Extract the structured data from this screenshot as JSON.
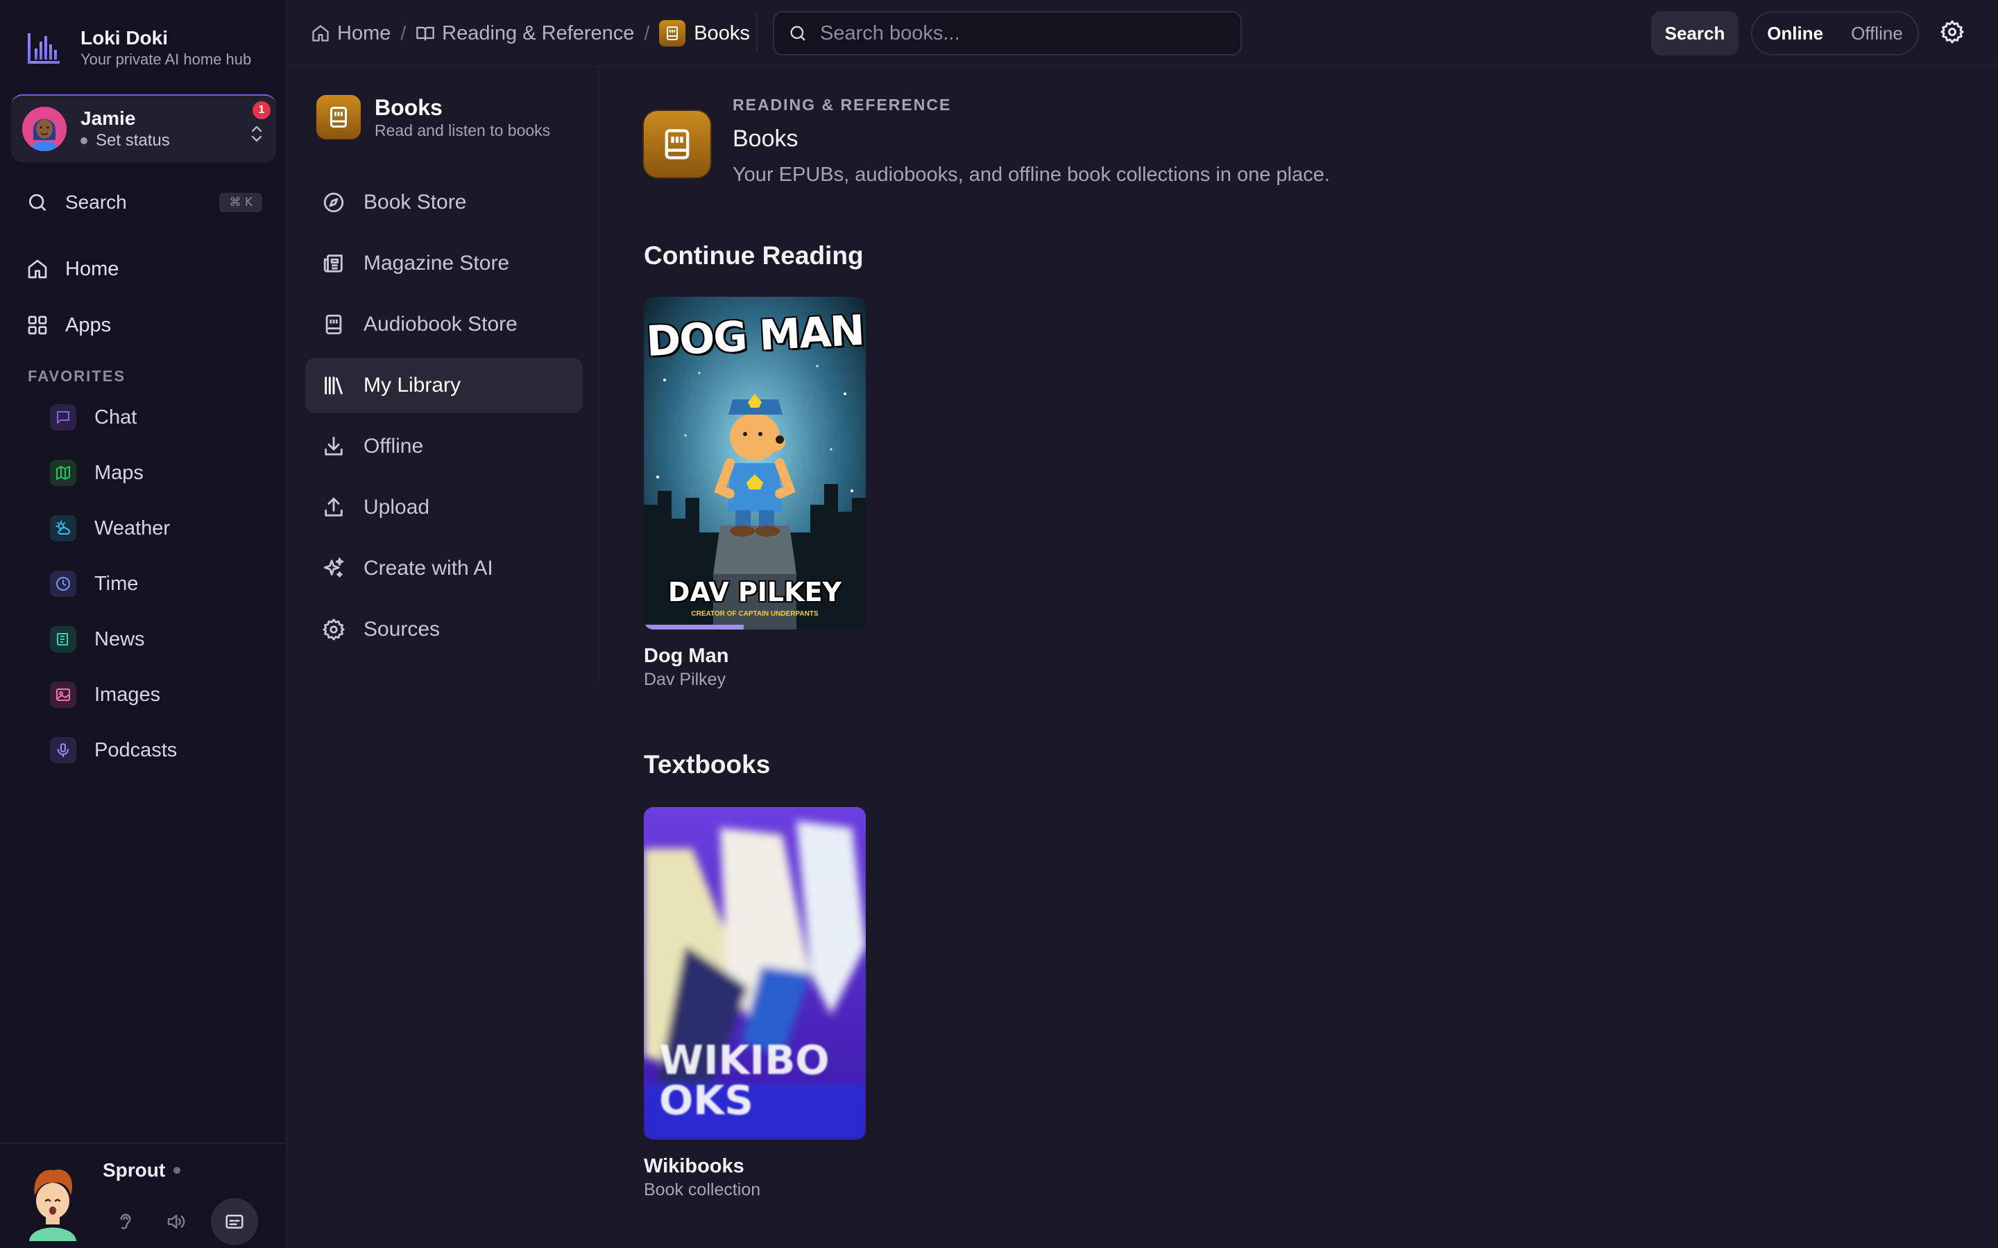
{
  "brand": {
    "name": "Loki Doki",
    "subtitle": "Your private AI home hub"
  },
  "user": {
    "name": "Jamie",
    "status": "Set status",
    "notifications": "1"
  },
  "sidebar": {
    "search_label": "Search",
    "search_shortcut": "⌘ K",
    "nav": [
      {
        "label": "Home",
        "icon": "home-icon"
      },
      {
        "label": "Apps",
        "icon": "grid-icon"
      }
    ],
    "favorites_heading": "FAVORITES",
    "favorites": [
      {
        "label": "Chat",
        "icon": "chat-icon",
        "color": "#8b5cf6"
      },
      {
        "label": "Maps",
        "icon": "map-icon",
        "color": "#22c55e"
      },
      {
        "label": "Weather",
        "icon": "weather-icon",
        "color": "#38bdf8"
      },
      {
        "label": "Time",
        "icon": "clock-icon",
        "color": "#818cf8"
      },
      {
        "label": "News",
        "icon": "newspaper-icon",
        "color": "#2dd4bf"
      },
      {
        "label": "Images",
        "icon": "image-icon",
        "color": "#f472b6"
      },
      {
        "label": "Podcasts",
        "icon": "mic-icon",
        "color": "#a78bfa"
      }
    ]
  },
  "assistant": {
    "name": "Sprout"
  },
  "topbar": {
    "breadcrumbs": [
      "Home",
      "Reading & Reference",
      "Books"
    ],
    "search_placeholder": "Search books...",
    "search_button": "Search",
    "mode_online": "Online",
    "mode_offline": "Offline"
  },
  "subnav": {
    "title": "Books",
    "description": "Read and listen to books",
    "items": [
      {
        "label": "Book Store",
        "icon": "compass-icon",
        "active": false
      },
      {
        "label": "Magazine Store",
        "icon": "newspaper-icon",
        "active": false
      },
      {
        "label": "Audiobook Store",
        "icon": "audiobook-icon",
        "active": false
      },
      {
        "label": "My Library",
        "icon": "library-icon",
        "active": true
      },
      {
        "label": "Offline",
        "icon": "download-icon",
        "active": false
      },
      {
        "label": "Upload",
        "icon": "upload-icon",
        "active": false
      },
      {
        "label": "Create with AI",
        "icon": "sparkle-icon",
        "active": false
      },
      {
        "label": "Sources",
        "icon": "gear-icon",
        "active": false
      }
    ]
  },
  "main": {
    "eyebrow": "READING & REFERENCE",
    "title": "Books",
    "description": "Your EPUBs, audiobooks, and offline book collections in one place.",
    "sections": [
      {
        "title": "Continue Reading",
        "books": [
          {
            "title": "Dog Man",
            "subtitle": "Dav Pilkey",
            "progress": 0.45,
            "cover_title": "DOG MAN",
            "cover_author": "DAV PILKEY",
            "cover_tagline": "CREATOR OF CAPTAIN UNDERPANTS"
          }
        ]
      },
      {
        "title": "Textbooks",
        "books": [
          {
            "title": "Wikibooks",
            "subtitle": "Book collection",
            "cover_title": "WIKIBO OKS"
          }
        ]
      }
    ]
  },
  "colors": {
    "accent": "#7b62d8",
    "book_gold": "#c98a1d",
    "badge": "#e0354b",
    "progress": "#9d8ff0"
  }
}
